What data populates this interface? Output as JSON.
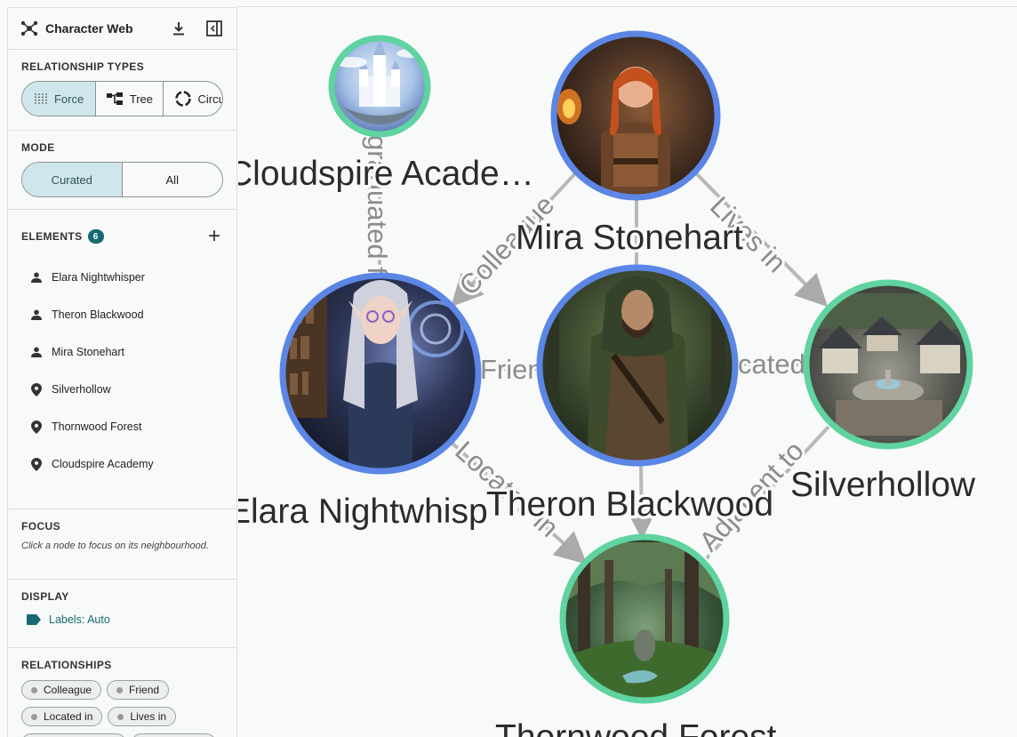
{
  "app": {
    "title": "Character Web"
  },
  "relationship_types": {
    "title": "RELATIONSHIP TYPES",
    "options": [
      {
        "label": "Force",
        "active": true
      },
      {
        "label": "Tree",
        "active": false
      },
      {
        "label": "Circu",
        "active": false
      }
    ]
  },
  "mode": {
    "title": "MODE",
    "options": [
      {
        "label": "Curated",
        "active": true
      },
      {
        "label": "All",
        "active": false
      }
    ]
  },
  "elements": {
    "title": "ELEMENTS",
    "count": "6",
    "items": [
      {
        "label": "Elara Nightwhisper",
        "icon": "person-icon"
      },
      {
        "label": "Theron Blackwood",
        "icon": "person-icon"
      },
      {
        "label": "Mira Stonehart",
        "icon": "person-icon"
      },
      {
        "label": "Silverhollow",
        "icon": "location-pin-icon"
      },
      {
        "label": "Thornwood Forest",
        "icon": "location-pin-icon"
      },
      {
        "label": "Cloudspire Academy",
        "icon": "location-pin-icon"
      }
    ]
  },
  "focus": {
    "title": "FOCUS",
    "text": "Click a node to focus on its neighbourhood."
  },
  "display": {
    "title": "DISPLAY",
    "labels": "Labels: Auto"
  },
  "relationships": {
    "title": "RELATIONSHIPS",
    "chips": [
      "Colleague",
      "Friend",
      "Located in",
      "Lives in"
    ]
  },
  "graph": {
    "nodes": [
      {
        "id": "cloudspire",
        "label": "Cloudspire Acade…",
        "kind": "location",
        "ring": "#5fd3a0"
      },
      {
        "id": "mira",
        "label": "Mira Stonehart",
        "kind": "character",
        "ring": "#5b86e5"
      },
      {
        "id": "elara",
        "label": "Elara Nightwhisp",
        "kind": "character",
        "ring": "#5b86e5"
      },
      {
        "id": "theron",
        "label": "Theron Blackwood",
        "kind": "character",
        "ring": "#5b86e5"
      },
      {
        "id": "silverhollow",
        "label": "Silverhollow",
        "kind": "location",
        "ring": "#5fd3a0"
      },
      {
        "id": "thornwood",
        "label": "Thornwood Forest",
        "kind": "location",
        "ring": "#5fd3a0"
      }
    ],
    "edge_labels": {
      "colleague": "Colleague",
      "lives_in": "Lives in",
      "friend": "Frien",
      "located": "cated",
      "located_in": "Located in",
      "adjacent_to": "Adjacent to",
      "graduated": "graduated f"
    }
  },
  "colors": {
    "accent": "#176a73",
    "character_ring": "#5b86e5",
    "location_ring": "#5fd3a0",
    "active_segment": "#cfe6ec"
  }
}
